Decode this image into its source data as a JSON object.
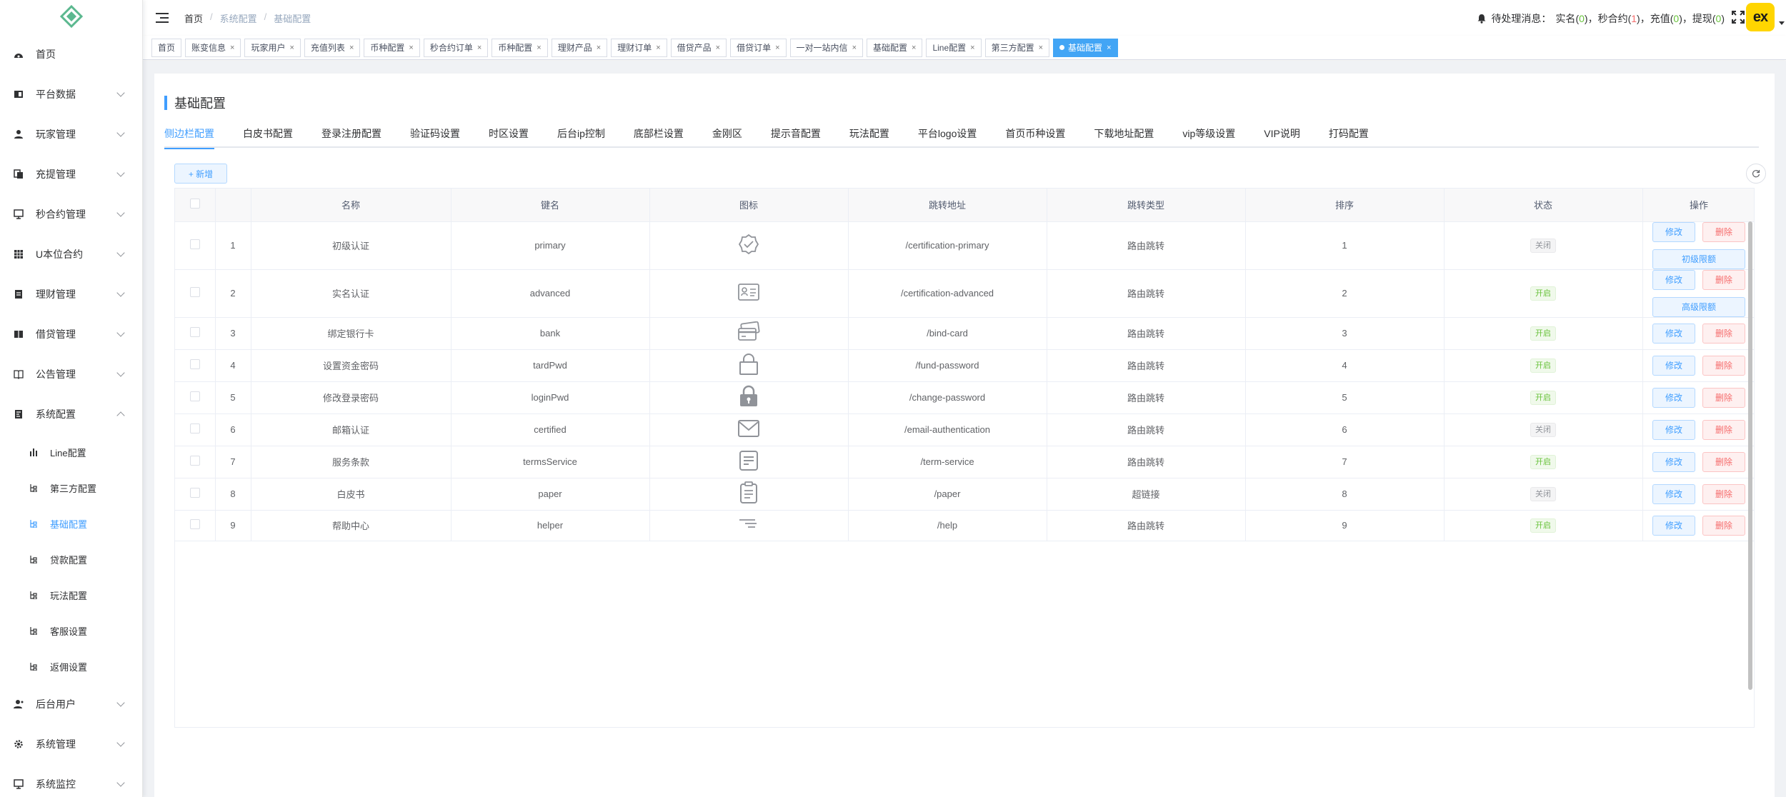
{
  "header": {
    "breadcrumb": [
      "首页",
      "系统配置",
      "基础配置"
    ],
    "notice_prefix": "待处理消息：",
    "notices": [
      {
        "label": "实名",
        "count": "0",
        "tone": "grn"
      },
      {
        "label": "秒合约",
        "count": "1",
        "tone": "red"
      },
      {
        "label": "充值",
        "count": "0",
        "tone": "grn"
      },
      {
        "label": "提现",
        "count": "0",
        "tone": "grn"
      }
    ],
    "avatar_text": "ex"
  },
  "sidebar": {
    "items": [
      {
        "label": "首页",
        "icon": "dashboard-icon",
        "arrow": false
      },
      {
        "label": "平台数据",
        "icon": "chart-icon",
        "arrow": true
      },
      {
        "label": "玩家管理",
        "icon": "user-icon",
        "arrow": true
      },
      {
        "label": "充提管理",
        "icon": "wallet-icon",
        "arrow": true
      },
      {
        "label": "秒合约管理",
        "icon": "monitor-icon",
        "arrow": true
      },
      {
        "label": "U本位合约",
        "icon": "grid-icon",
        "arrow": true
      },
      {
        "label": "理财管理",
        "icon": "document-icon",
        "arrow": true
      },
      {
        "label": "借贷管理",
        "icon": "book-icon",
        "arrow": true
      },
      {
        "label": "公告管理",
        "icon": "notice-icon",
        "arrow": true
      },
      {
        "label": "系统配置",
        "icon": "settings-doc-icon",
        "arrow": true,
        "expanded": true
      }
    ],
    "sub_items": [
      {
        "label": "Line配置",
        "icon": "bar-chart-icon",
        "active": false
      },
      {
        "label": "第三方配置",
        "icon": "tree-icon",
        "active": false
      },
      {
        "label": "基础配置",
        "icon": "tree-icon",
        "active": true
      },
      {
        "label": "贷款配置",
        "icon": "tree-icon",
        "active": false
      },
      {
        "label": "玩法配置",
        "icon": "tree-icon",
        "active": false
      },
      {
        "label": "客服设置",
        "icon": "tree-icon",
        "active": false
      },
      {
        "label": "返佣设置",
        "icon": "tree-icon",
        "active": false
      }
    ],
    "bottom_items": [
      {
        "label": "后台用户",
        "icon": "admin-user-icon",
        "arrow": true
      },
      {
        "label": "系统管理",
        "icon": "gear-icon",
        "arrow": true
      },
      {
        "label": "系统监控",
        "icon": "monitor-icon",
        "arrow": true
      }
    ]
  },
  "tags": [
    {
      "label": "首页",
      "closable": false
    },
    {
      "label": "账变信息",
      "closable": true
    },
    {
      "label": "玩家用户",
      "closable": true
    },
    {
      "label": "充值列表",
      "closable": true
    },
    {
      "label": "币种配置",
      "closable": true
    },
    {
      "label": "秒合约订单",
      "closable": true
    },
    {
      "label": "币种配置",
      "closable": true
    },
    {
      "label": "理财产品",
      "closable": true
    },
    {
      "label": "理财订单",
      "closable": true
    },
    {
      "label": "借贷产品",
      "closable": true
    },
    {
      "label": "借贷订单",
      "closable": true
    },
    {
      "label": "一对一站内信",
      "closable": true
    },
    {
      "label": "基础配置",
      "closable": true
    },
    {
      "label": "Line配置",
      "closable": true
    },
    {
      "label": "第三方配置",
      "closable": true
    },
    {
      "label": "基础配置",
      "closable": true,
      "active": true
    }
  ],
  "page": {
    "title": "基础配置",
    "tabs": [
      "侧边栏配置",
      "白皮书配置",
      "登录注册配置",
      "验证码设置",
      "时区设置",
      "后台ip控制",
      "底部栏设置",
      "金刚区",
      "提示音配置",
      "玩法配置",
      "平台logo设置",
      "首页币种设置",
      "下载地址配置",
      "vip等级设置",
      "VIP说明",
      "打码配置"
    ],
    "active_tab": 0,
    "add_button": "+ 新增"
  },
  "table": {
    "columns": [
      "",
      "",
      "名称",
      "键名",
      "图标",
      "跳转地址",
      "跳转类型",
      "排序",
      "状态",
      "操作"
    ],
    "edit_label": "修改",
    "delete_label": "删除",
    "rows": [
      {
        "index": "1",
        "name": "初级认证",
        "key": "primary",
        "icon": "badge-check-icon",
        "url": "/certification-primary",
        "type": "路由跳转",
        "sort": "1",
        "status": "关闭",
        "status_on": false,
        "extra": "初级限额"
      },
      {
        "index": "2",
        "name": "实名认证",
        "key": "advanced",
        "icon": "id-card-icon",
        "url": "/certification-advanced",
        "type": "路由跳转",
        "sort": "2",
        "status": "开启",
        "status_on": true,
        "extra": "高级限额"
      },
      {
        "index": "3",
        "name": "绑定银行卡",
        "key": "bank",
        "icon": "bank-card-icon",
        "url": "/bind-card",
        "type": "路由跳转",
        "sort": "3",
        "status": "开启",
        "status_on": true,
        "extra": ""
      },
      {
        "index": "4",
        "name": "设置资金密码",
        "key": "tardPwd",
        "icon": "lock-outline-icon",
        "url": "/fund-password",
        "type": "路由跳转",
        "sort": "4",
        "status": "开启",
        "status_on": true,
        "extra": ""
      },
      {
        "index": "5",
        "name": "修改登录密码",
        "key": "loginPwd",
        "icon": "lock-filled-icon",
        "url": "/change-password",
        "type": "路由跳转",
        "sort": "5",
        "status": "开启",
        "status_on": true,
        "extra": ""
      },
      {
        "index": "6",
        "name": "邮箱认证",
        "key": "certified",
        "icon": "mail-icon",
        "url": "/email-authentication",
        "type": "路由跳转",
        "sort": "6",
        "status": "关闭",
        "status_on": false,
        "extra": ""
      },
      {
        "index": "7",
        "name": "服务条款",
        "key": "termsService",
        "icon": "terms-doc-icon",
        "url": "/term-service",
        "type": "路由跳转",
        "sort": "7",
        "status": "开启",
        "status_on": true,
        "extra": ""
      },
      {
        "index": "8",
        "name": "白皮书",
        "key": "paper",
        "icon": "clipboard-icon",
        "url": "/paper",
        "type": "超链接",
        "sort": "8",
        "status": "关闭",
        "status_on": false,
        "extra": ""
      },
      {
        "index": "9",
        "name": "帮助中心",
        "key": "helper",
        "icon": "help-lines-icon",
        "url": "/help",
        "type": "路由跳转",
        "sort": "9",
        "status": "开启",
        "status_on": true,
        "extra": ""
      }
    ]
  }
}
